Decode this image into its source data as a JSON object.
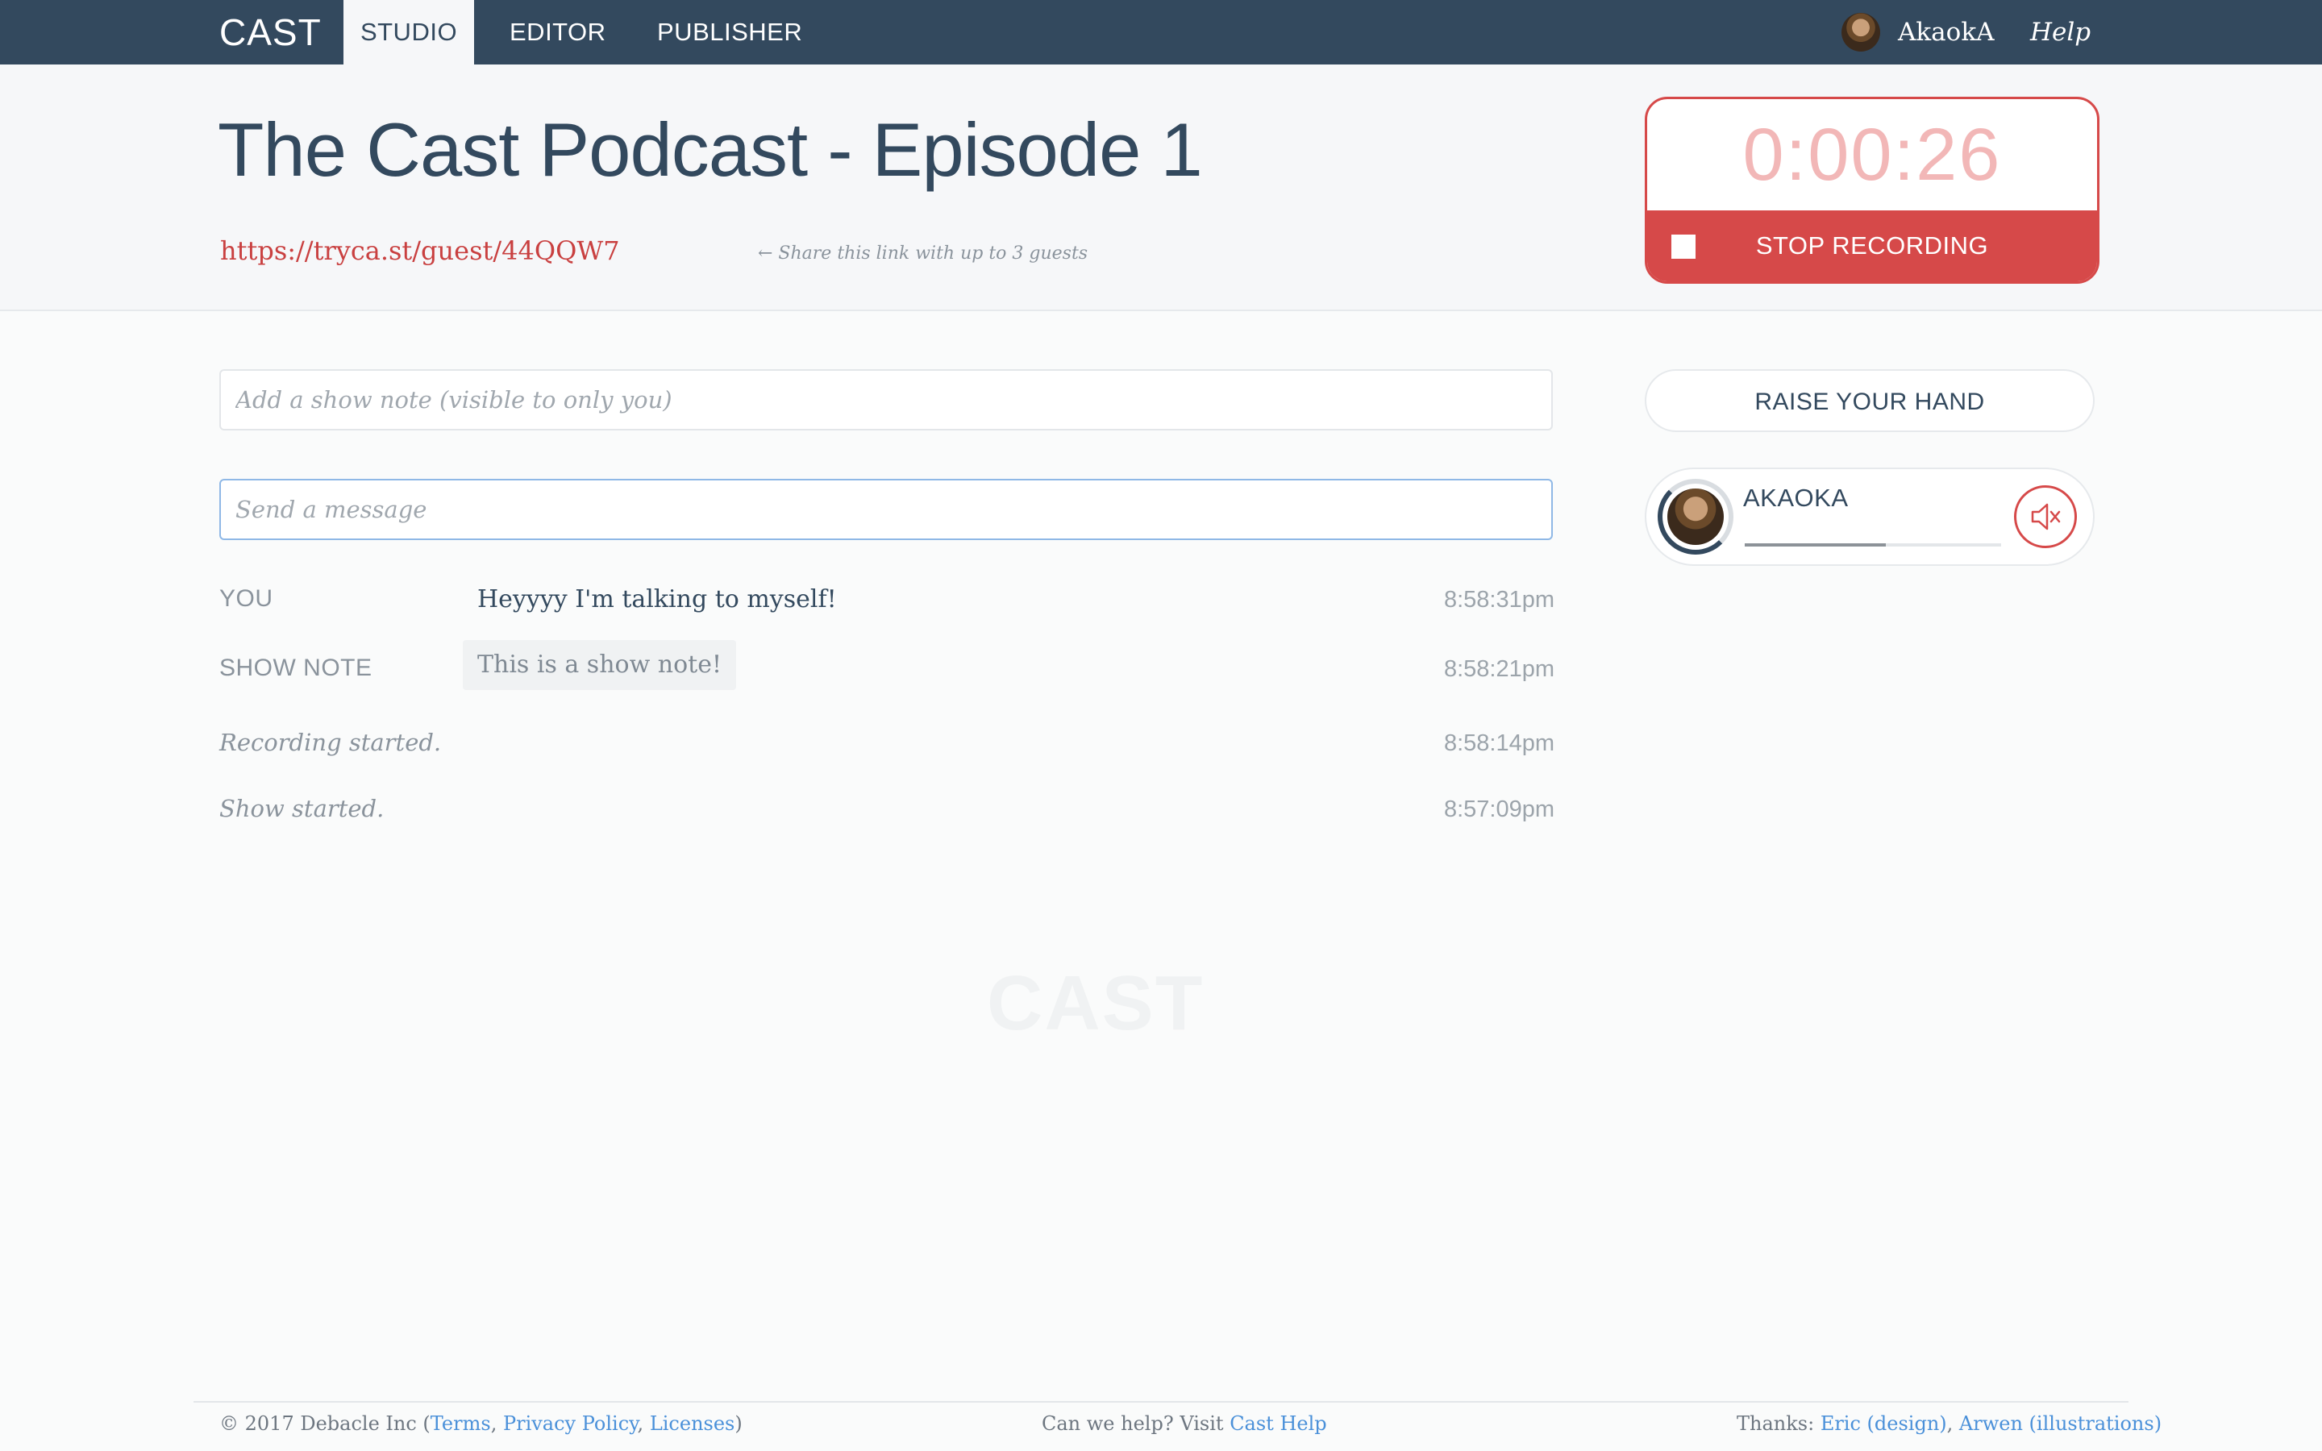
{
  "nav": {
    "logo": "CAST",
    "tabs": [
      {
        "label": "STUDIO",
        "active": true
      },
      {
        "label": "EDITOR",
        "active": false
      },
      {
        "label": "PUBLISHER",
        "active": false
      }
    ],
    "user_name": "AkaokA",
    "help_label": "Help"
  },
  "header": {
    "title": "The Cast Podcast - Episode 1",
    "guest_link": "https://tryca.st/guest/44QQW7",
    "share_hint": "← Share this link with up to 3 guests"
  },
  "timer": {
    "value": "0:00:26",
    "stop_label": "STOP RECORDING"
  },
  "inputs": {
    "show_note_placeholder": "Add a show note (visible to only you)",
    "message_placeholder": "Send a message"
  },
  "messages": [
    {
      "who": "YOU",
      "text": "Heyyyy I'm talking to myself!",
      "time": "8:58:31pm",
      "kind": "chat"
    },
    {
      "who": "SHOW NOTE",
      "text": "This is a show note!",
      "time": "8:58:21pm",
      "kind": "note"
    },
    {
      "text": "Recording started.",
      "time": "8:58:14pm",
      "kind": "event"
    },
    {
      "text": "Show started.",
      "time": "8:57:09pm",
      "kind": "event"
    }
  ],
  "panel": {
    "raise_hand_label": "RAISE YOUR HAND",
    "guest_name": "AKAOKA",
    "audio_level": 0.55,
    "mute_icon": "speaker-muted-icon"
  },
  "watermark": "CAST",
  "footer": {
    "copyright": "© 2017 Debacle Inc (",
    "terms": "Terms",
    "privacy": "Privacy Policy",
    "licenses": "Licenses",
    "help_prefix": "Can we help? Visit ",
    "help_link": "Cast Help",
    "thanks_prefix": "Thanks: ",
    "eric": "Eric (design)",
    "arwen": "Arwen (illustrations)"
  },
  "colors": {
    "nav_bg": "#33495e",
    "accent_red": "#d64949",
    "link_blue": "#4a90d9"
  }
}
